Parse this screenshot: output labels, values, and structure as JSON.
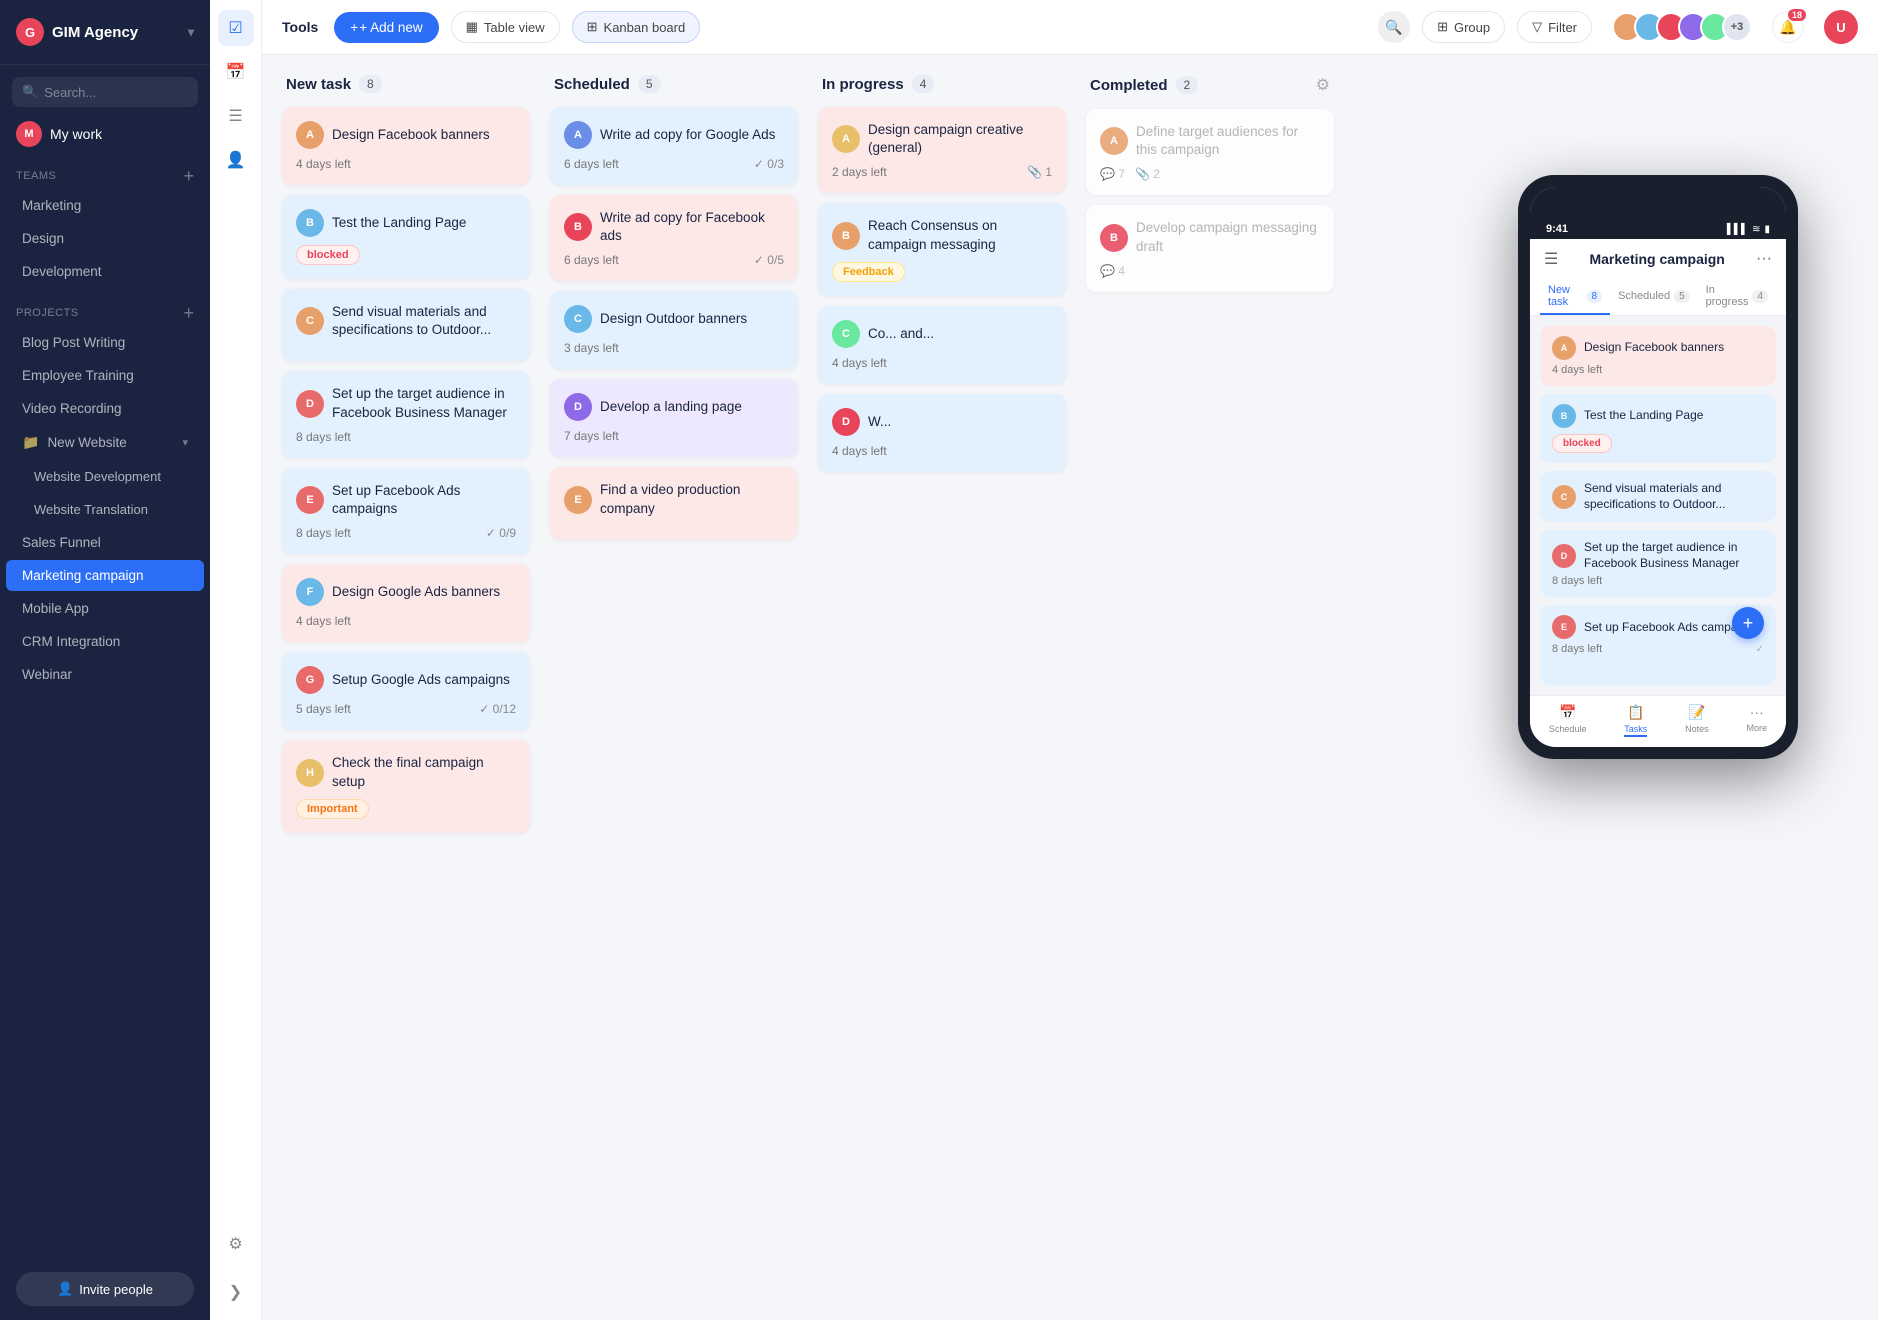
{
  "app": {
    "name": "GIM Agency",
    "logo_letter": "G"
  },
  "sidebar": {
    "search_placeholder": "Search...",
    "my_work": "My work",
    "teams_label": "Teams",
    "teams": [
      "Marketing",
      "Design",
      "Development"
    ],
    "projects_label": "Projects",
    "projects": [
      {
        "label": "Blog Post Writing",
        "sub": false
      },
      {
        "label": "Employee Training",
        "sub": false
      },
      {
        "label": "Video Recording",
        "sub": false
      },
      {
        "label": "New Website",
        "sub": false,
        "folder": true,
        "expanded": true
      },
      {
        "label": "Website Development",
        "sub": true
      },
      {
        "label": "Website Translation",
        "sub": true
      },
      {
        "label": "Sales Funnel",
        "sub": false
      },
      {
        "label": "Marketing campaign",
        "sub": false,
        "active": true
      },
      {
        "label": "Mobile App",
        "sub": false
      },
      {
        "label": "CRM Integration",
        "sub": false
      },
      {
        "label": "Webinar",
        "sub": false
      }
    ],
    "invite_label": "Invite people"
  },
  "topbar": {
    "tools": "Tools",
    "add_new": "+ Add new",
    "table_view": "Table view",
    "kanban_board": "Kanban board",
    "group": "Group",
    "filter": "Filter",
    "avatars_extra": "+3",
    "notifications_count": "18"
  },
  "columns": [
    {
      "id": "new_task",
      "title": "New task",
      "count": 8,
      "cards": [
        {
          "id": "nt1",
          "title": "Design Facebook banners",
          "days": "4 days left",
          "color": "pink",
          "avatar_color": "#e8a06a"
        },
        {
          "id": "nt2",
          "title": "Test the Landing Page",
          "badge": "blocked",
          "badge_type": "blocked",
          "color": "blue",
          "avatar_color": "#6ab8e8"
        },
        {
          "id": "nt3",
          "title": "Send visual materials and specifications to Outdoor...",
          "color": "blue",
          "avatar_color": "#e8a06a"
        },
        {
          "id": "nt4",
          "title": "Set up the target audience in Facebook Business Manager",
          "days": "8 days left",
          "color": "blue",
          "avatar_color": "#e86a6a"
        },
        {
          "id": "nt5",
          "title": "Set up Facebook Ads campaigns",
          "days": "8 days left",
          "meta_check": "0/9",
          "color": "blue",
          "avatar_color": "#e86a6a"
        },
        {
          "id": "nt6",
          "title": "Design Google Ads banners",
          "days": "4 days left",
          "color": "pink",
          "avatar_color": "#6ab8e8"
        },
        {
          "id": "nt7",
          "title": "Setup Google Ads campaigns",
          "days": "5 days left",
          "meta_check": "0/12",
          "color": "blue",
          "avatar_color": "#e86a6a"
        },
        {
          "id": "nt8",
          "title": "Check the final campaign setup",
          "badge": "Important",
          "badge_type": "important",
          "color": "pink",
          "avatar_color": "#e8c06a"
        }
      ]
    },
    {
      "id": "scheduled",
      "title": "Scheduled",
      "count": 5,
      "cards": [
        {
          "id": "sc1",
          "title": "Write ad copy for Google Ads",
          "days": "6 days left",
          "meta_check": "0/3",
          "color": "blue",
          "avatar_color": "#6a8ee8"
        },
        {
          "id": "sc2",
          "title": "Write ad copy for Facebook ads",
          "days": "6 days left",
          "meta_check": "0/5",
          "color": "pink",
          "avatar_color": "#e8445a"
        },
        {
          "id": "sc3",
          "title": "Design Outdoor banners",
          "days": "3 days left",
          "color": "blue",
          "avatar_color": "#6ab8e8"
        },
        {
          "id": "sc4",
          "title": "Develop a landing page",
          "days": "7 days left",
          "color": "purple",
          "avatar_color": "#8e6ae8"
        },
        {
          "id": "sc5",
          "title": "Find a video production company",
          "color": "pink",
          "avatar_color": "#e8a06a"
        }
      ]
    },
    {
      "id": "in_progress",
      "title": "In progress",
      "count": 4,
      "cards": [
        {
          "id": "ip1",
          "title": "Design campaign creative (general)",
          "days": "2 days left",
          "meta_attach": "1",
          "color": "pink",
          "avatar_color": "#e8c06a"
        },
        {
          "id": "ip2",
          "title": "Reach Consensus on campaign messaging",
          "badge": "Feedback",
          "badge_type": "feedback",
          "color": "blue",
          "avatar_color": "#e8a06a"
        },
        {
          "id": "ip3",
          "title": "Co... and...",
          "days": "4 days left",
          "color": "blue",
          "avatar_color": "#6ae8a0"
        },
        {
          "id": "ip4",
          "title": "W...",
          "days": "4 days left",
          "color": "blue",
          "avatar_color": "#e8445a"
        }
      ]
    },
    {
      "id": "completed",
      "title": "Completed",
      "count": 2,
      "cards": [
        {
          "id": "cp1",
          "title": "Define target audiences for this campaign",
          "meta_comment": "7",
          "meta_attach": "2",
          "color": "white",
          "avatar_color": "#e8a06a"
        },
        {
          "id": "cp2",
          "title": "Develop campaign messaging draft",
          "meta_comment": "4",
          "color": "white",
          "avatar_color": "#e8445a"
        }
      ]
    }
  ],
  "mobile": {
    "time": "9:41",
    "title": "Marketing campaign",
    "tabs": [
      {
        "label": "New task",
        "count": 8,
        "active": true
      },
      {
        "label": "Scheduled",
        "count": 5,
        "active": false
      },
      {
        "label": "In progress",
        "count": 4,
        "active": false
      }
    ],
    "cards": [
      {
        "title": "Design Facebook banners",
        "days": "4 days left",
        "color": "pink",
        "avatar_color": "#e8a06a"
      },
      {
        "title": "Test the Landing Page",
        "badge": "blocked",
        "color": "blue",
        "avatar_color": "#6ab8e8"
      },
      {
        "title": "Send visual materials and specifications to Outdoor...",
        "color": "blue",
        "avatar_color": "#e8a06a"
      },
      {
        "title": "Set up the target audience in Facebook Business Manager",
        "days": "8 days left",
        "color": "blue",
        "avatar_color": "#e86a6a"
      },
      {
        "title": "Set up Facebook Ads campaigns",
        "days": "8 days left",
        "color": "blue",
        "avatar_color": "#e86a6a"
      }
    ],
    "nav": [
      "Schedule",
      "Tasks",
      "Notes",
      "More"
    ],
    "nav_icons": [
      "📅",
      "📋",
      "📝",
      "···"
    ],
    "active_nav": 1,
    "fab_label": "+"
  }
}
